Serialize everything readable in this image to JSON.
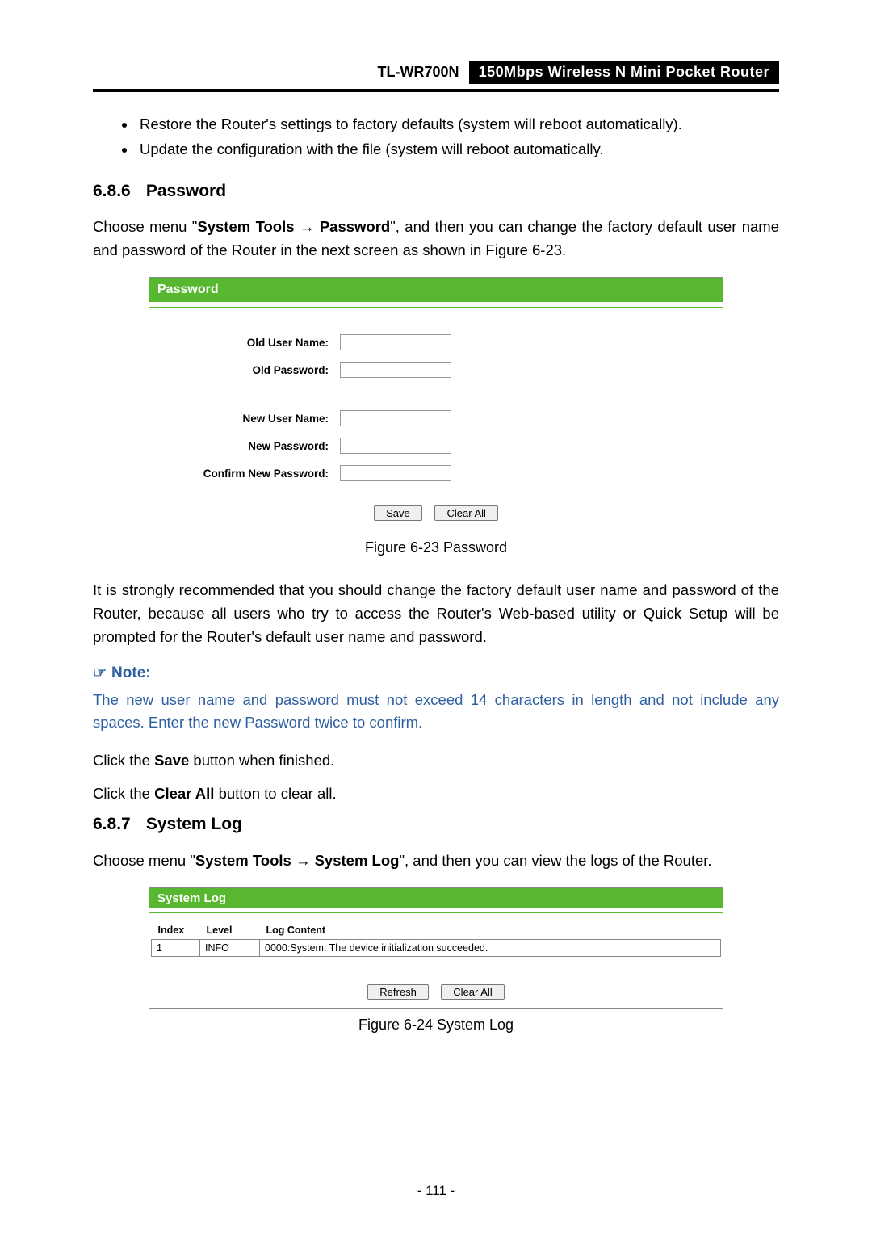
{
  "header": {
    "model": "TL-WR700N",
    "description": "150Mbps Wireless N Mini Pocket Router"
  },
  "bullets": [
    "Restore the Router's settings to factory defaults (system will reboot automatically).",
    "Update the configuration with the file (system will reboot automatically."
  ],
  "sections": {
    "password": {
      "number": "6.8.6",
      "title": "Password"
    },
    "syslog": {
      "number": "6.8.7",
      "title": "System Log"
    }
  },
  "password_intro": {
    "pre": "Choose menu \"",
    "menu1": "System Tools",
    "arrow": "→",
    "menu2": "Password",
    "post": "\", and then you can change the factory default user name and password of the Router in the next screen as shown in Figure 6-23."
  },
  "password_panel": {
    "title": "Password",
    "labels": {
      "old_user": "Old User Name:",
      "old_pass": "Old Password:",
      "new_user": "New User Name:",
      "new_pass": "New Password:",
      "confirm": "Confirm New Password:"
    },
    "buttons": {
      "save": "Save",
      "clear": "Clear All"
    }
  },
  "captions": {
    "fig23": "Figure 6-23    Password",
    "fig24": "Figure 6-24    System Log"
  },
  "password_notice": "It is strongly recommended that you should change the factory default user name and password of the Router, because all users who try to access the Router's Web-based utility or Quick Setup will be prompted for the Router's default user name and password.",
  "note": {
    "label": "Note:",
    "body": "The new user name and password must not exceed 14 characters in length and not include any spaces. Enter the new Password twice to confirm."
  },
  "save_line": {
    "pre": "Click the ",
    "bold": "Save",
    "post": " button when finished."
  },
  "clear_line": {
    "pre": "Click the ",
    "bold": "Clear All",
    "post": " button to clear all."
  },
  "syslog_intro": {
    "pre": "Choose menu \"",
    "menu1": "System Tools",
    "arrow": "→",
    "menu2": "System Log",
    "post": "\", and then you can view the logs of the Router."
  },
  "syslog_panel": {
    "title": "System Log",
    "headers": {
      "index": "Index",
      "level": "Level",
      "content": "Log Content"
    },
    "rows": [
      {
        "index": "1",
        "level": "INFO",
        "content": "0000:System: The device initialization succeeded."
      }
    ],
    "buttons": {
      "refresh": "Refresh",
      "clear": "Clear All"
    }
  },
  "page_number": "- 111 -"
}
